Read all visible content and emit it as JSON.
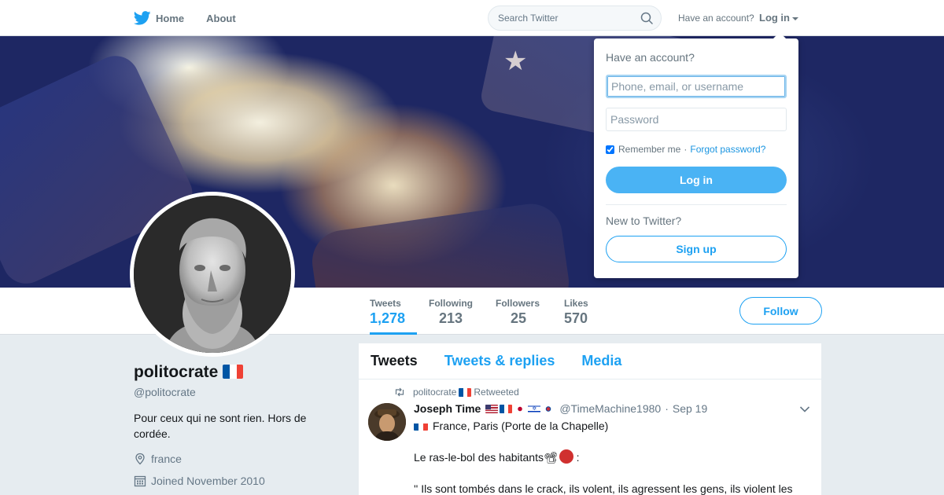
{
  "nav": {
    "home_label": "Home",
    "about_label": "About",
    "search_placeholder": "Search Twitter",
    "have_account": "Have an account?",
    "login_label": "Log in"
  },
  "profile": {
    "name": "politocrate",
    "handle": "@politocrate",
    "bio": "Pour ceux qui ne sont rien. Hors de cordée.",
    "location": "france",
    "joined": "Joined November 2010",
    "follow_label": "Follow"
  },
  "stats": [
    {
      "label": "Tweets",
      "value": "1,278"
    },
    {
      "label": "Following",
      "value": "213"
    },
    {
      "label": "Followers",
      "value": "25"
    },
    {
      "label": "Likes",
      "value": "570"
    }
  ],
  "timeline": {
    "tabs": [
      {
        "label": "Tweets"
      },
      {
        "label": "Tweets & replies"
      },
      {
        "label": "Media"
      }
    ]
  },
  "tweet": {
    "retweeted_by": "politocrate",
    "retweeted_label": "Retweeted",
    "author_name": "Joseph Time",
    "author_handle": "@TimeMachine1980",
    "date": "Sep 19",
    "line1": "France, Paris (Porte de la Chapelle)",
    "line2": "Le ras-le-bol des habitants",
    "line2_suffix": " :",
    "line3": "'' Ils sont tombés dans le crack, ils volent, ils agressent les gens, ils violent les"
  },
  "login_dropdown": {
    "title": "Have an account?",
    "username_placeholder": "Phone, email, or username",
    "password_placeholder": "Password",
    "remember_label": "Remember me",
    "separator": "·",
    "forgot_label": "Forgot password?",
    "login_button": "Log in",
    "new_label": "New to Twitter?",
    "signup_button": "Sign up"
  },
  "colors": {
    "accent": "#1da1f2",
    "login_button": "#4ab3f4",
    "background": "#e6ecf0"
  },
  "icons": {
    "logo": "twitter-bird-icon",
    "search": "search-icon",
    "location": "location-pin-icon",
    "calendar": "calendar-icon",
    "retweet": "retweet-icon",
    "caret": "chevron-down-icon"
  }
}
